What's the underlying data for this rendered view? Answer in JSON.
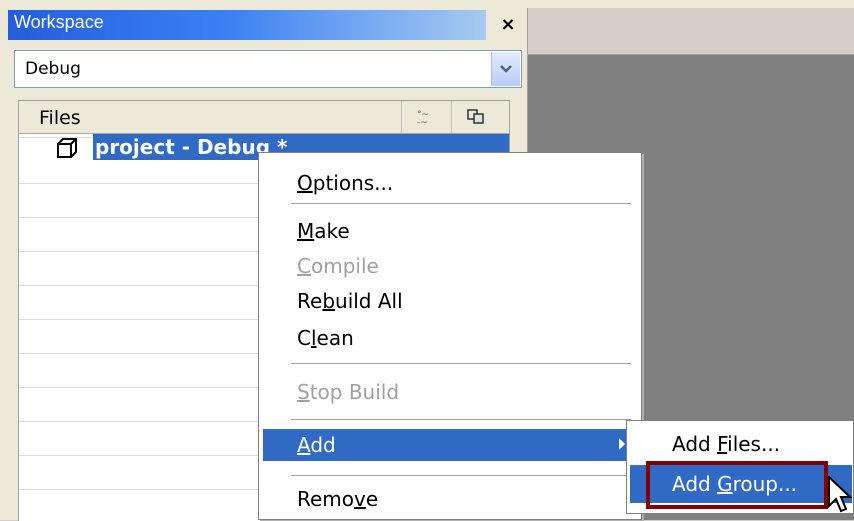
{
  "workspace": {
    "title": "Workspace",
    "close_glyph": "×",
    "config_value": "Debug",
    "files_header": "Files",
    "project_label": "project - Debug *"
  },
  "context_menu": {
    "items": [
      {
        "pre": "",
        "key": "O",
        "post": "ptions...",
        "enabled": true
      },
      {
        "pre": "",
        "key": "M",
        "post": "ake",
        "enabled": true
      },
      {
        "pre": "",
        "key": "C",
        "post": "ompile",
        "enabled": false
      },
      {
        "pre": "Re",
        "key": "b",
        "post": "uild All",
        "enabled": true
      },
      {
        "pre": "C",
        "key": "l",
        "post": "ean",
        "enabled": true
      },
      {
        "pre": "",
        "key": "S",
        "post": "top Build",
        "enabled": false
      },
      {
        "pre": "",
        "key": "A",
        "post": "dd",
        "enabled": true,
        "active": true,
        "has_submenu": true
      },
      {
        "pre": "Remo",
        "key": "v",
        "post": "e",
        "enabled": true
      }
    ]
  },
  "submenu": {
    "items": [
      {
        "pre": "Add ",
        "key": "F",
        "post": "iles..."
      },
      {
        "pre": "Add ",
        "key": "G",
        "post": "roup...",
        "active": true
      }
    ]
  },
  "colors": {
    "selection": "#316ac5",
    "highlight_box": "#800000"
  }
}
